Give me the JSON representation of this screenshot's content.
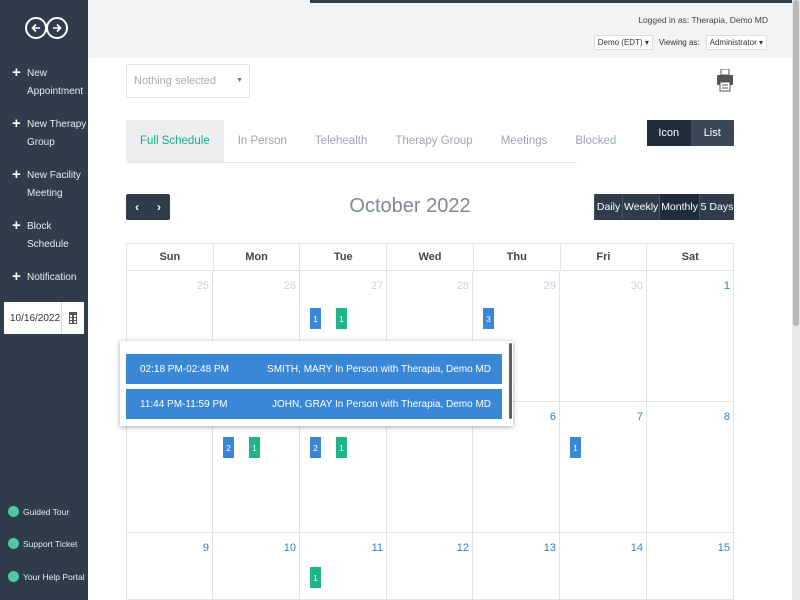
{
  "sidebar": {
    "items": [
      {
        "label_line1": "New",
        "label_line2": "Appointment"
      },
      {
        "label_line1": "New Therapy",
        "label_line2": "Group"
      },
      {
        "label_line1": "New Facility",
        "label_line2": "Meeting"
      },
      {
        "label_line1": "Block",
        "label_line2": "Schedule"
      },
      {
        "label_line1": "Notification",
        "label_line2": ""
      }
    ],
    "date_value": "10/16/2022",
    "footer": [
      {
        "label": "Guided Tour",
        "icon": "guided-tour-icon"
      },
      {
        "label": "Support Ticket",
        "icon": "support-ticket-icon"
      },
      {
        "label": "Your Help Portal",
        "icon": "help-portal-icon"
      }
    ]
  },
  "header": {
    "logged_in": "Logged in as: Therapia, Demo MD",
    "timezone": "Demo (EDT) ▾",
    "viewing_label": "Viewing as:",
    "viewing_value": "Administrator ▾"
  },
  "filter": {
    "placeholder": "Nothing selected"
  },
  "tabs": [
    "Full Schedule",
    "In Person",
    "Telehealth",
    "Therapy Group",
    "Meetings",
    "Blocked"
  ],
  "view_toggle": {
    "icon": "Icon",
    "list": "List"
  },
  "calendar": {
    "title": "October 2022",
    "nav_prev": "‹",
    "nav_next": "›",
    "ranges": [
      "Daily",
      "Weekly",
      "Monthly",
      "5 Days"
    ],
    "weekdays": [
      "Sun",
      "Mon",
      "Tue",
      "Wed",
      "Thu",
      "Fri",
      "Sat"
    ],
    "week1": [
      "25",
      "26",
      "27",
      "28",
      "29",
      "30",
      "1"
    ],
    "week2": [
      "6",
      "7",
      "8"
    ],
    "week3": [
      "9",
      "10",
      "11",
      "12",
      "13",
      "14",
      "15"
    ],
    "badges": {
      "w1_tue_a": "1",
      "w1_tue_b": "1",
      "w1_thu": "3",
      "w2_mon_a": "2",
      "w2_mon_b": "1",
      "w2_tue_a": "2",
      "w2_tue_b": "1",
      "w2_fri": "1",
      "w3_tue": "1"
    }
  },
  "popup": {
    "appointments": [
      {
        "time": "02:18 PM-02:48 PM",
        "desc": "SMITH, MARY In Person with Therapia, Demo MD"
      },
      {
        "time": "11:44 PM-11:59 PM",
        "desc": "JOHN, GRAY In Person with Therapia, Demo MD"
      }
    ]
  },
  "colors": {
    "sidebar": "#2f3d4a",
    "accent_green": "#1aa98a",
    "badge_blue": "#3b86d6",
    "badge_green": "#20b48a"
  }
}
